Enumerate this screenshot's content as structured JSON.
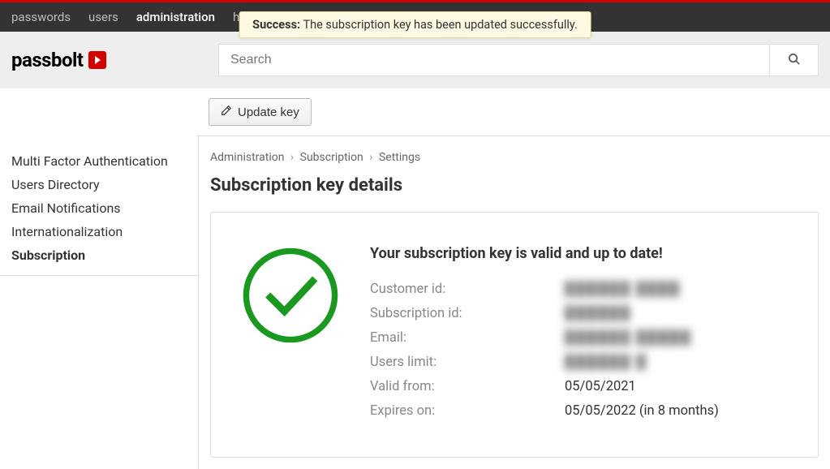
{
  "topnav": {
    "items": [
      {
        "label": "passwords"
      },
      {
        "label": "users"
      },
      {
        "label": "administration"
      },
      {
        "label": "help"
      }
    ]
  },
  "notice": {
    "success_label": "Success:",
    "message": " The subscription key has been updated successfully."
  },
  "search": {
    "placeholder": "Search"
  },
  "logo": {
    "text": "passbolt"
  },
  "actions": {
    "update_key_label": "Update key"
  },
  "sidebar": {
    "items": [
      {
        "label": "Multi Factor Authentication"
      },
      {
        "label": "Users Directory"
      },
      {
        "label": "Email Notifications"
      },
      {
        "label": "Internationalization"
      },
      {
        "label": "Subscription"
      }
    ]
  },
  "breadcrumb": {
    "a": "Administration",
    "b": "Subscription",
    "c": "Settings"
  },
  "page": {
    "title": "Subscription key details"
  },
  "subscription": {
    "valid_message": "Your subscription key is valid and up to date!",
    "labels": {
      "customer_id": "Customer id:",
      "subscription_id": "Subscription id:",
      "email": "Email:",
      "users_limit": "Users limit:",
      "valid_from": "Valid from:",
      "expires_on": "Expires on:"
    },
    "values": {
      "customer_id": "██████ ████",
      "subscription_id": "██████",
      "email": "██████ █████",
      "users_limit": "██████ █",
      "valid_from": "05/05/2021",
      "expires_on": "05/05/2022 (in 8 months)"
    }
  }
}
